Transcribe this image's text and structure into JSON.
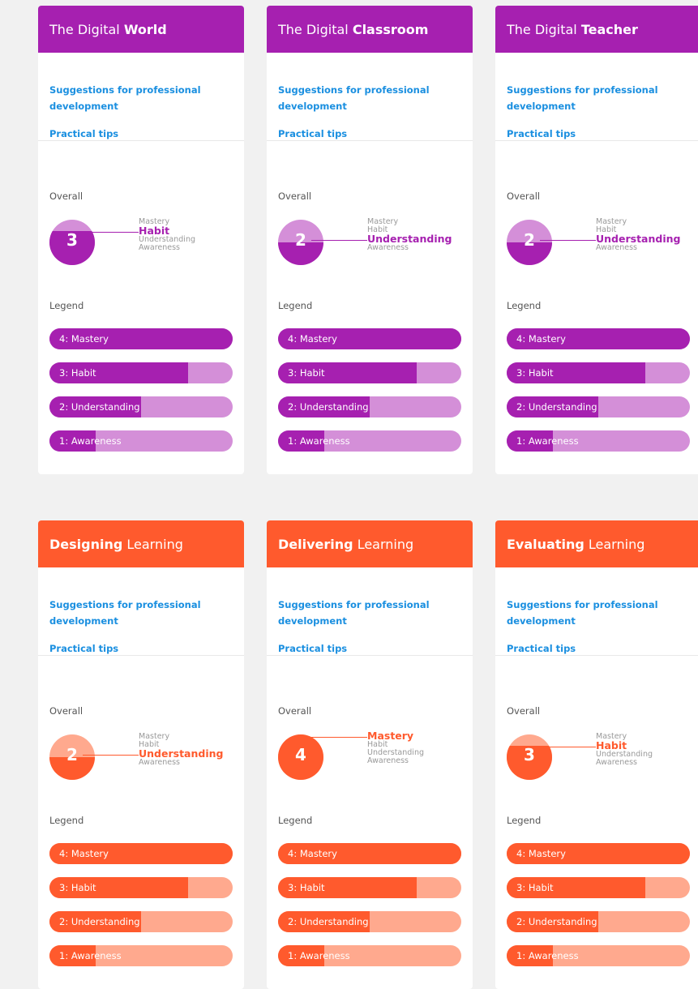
{
  "common": {
    "suggestions_link": "Suggestions for professional development",
    "tips_link": "Practical tips",
    "overall_label": "Overall",
    "legend_label": "Legend",
    "level_names": [
      "Mastery",
      "Habit",
      "Understanding",
      "Awareness"
    ],
    "legend_items": [
      "4: Mastery",
      "3: Habit",
      "2: Understanding",
      "1: Awareness"
    ],
    "legend_fill": [
      1.0,
      0.755,
      0.5,
      0.25
    ]
  },
  "themes": {
    "purple": {
      "dark": "#a620b0",
      "light": "#d48fd8"
    },
    "orange": {
      "dark": "#ff5a2d",
      "light": "#ffa98e"
    }
  },
  "cards": [
    {
      "title_a": "The Digital ",
      "title_b": "World",
      "bold_first": false,
      "theme": "purple",
      "score": "3",
      "active_level": "Habit"
    },
    {
      "title_a": "The Digital ",
      "title_b": "Classroom",
      "bold_first": false,
      "theme": "purple",
      "score": "2",
      "active_level": "Understanding"
    },
    {
      "title_a": "The Digital ",
      "title_b": "Teacher",
      "bold_first": false,
      "theme": "purple",
      "score": "2",
      "active_level": "Understanding"
    },
    {
      "title_a": "Designing",
      "title_b": " Learning",
      "bold_first": true,
      "theme": "orange",
      "score": "2",
      "active_level": "Understanding"
    },
    {
      "title_a": "Delivering",
      "title_b": " Learning",
      "bold_first": true,
      "theme": "orange",
      "score": "4",
      "active_level": "Mastery"
    },
    {
      "title_a": "Evaluating",
      "title_b": " Learning",
      "bold_first": true,
      "theme": "orange",
      "score": "3",
      "active_level": "Habit"
    }
  ]
}
